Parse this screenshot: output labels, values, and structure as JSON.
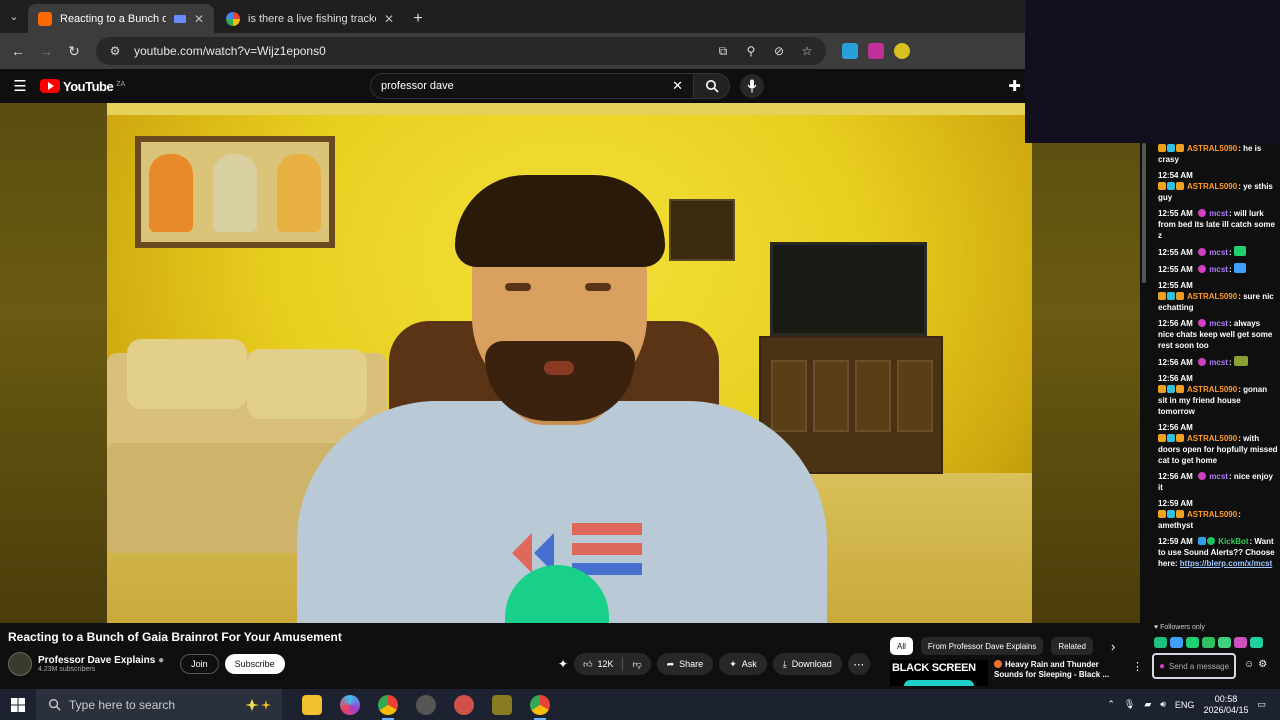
{
  "browser": {
    "tabs": [
      {
        "title": "Reacting to a Bunch of Gaia",
        "active": true
      },
      {
        "title": "is there a live fishing tracker ap",
        "active": false
      }
    ],
    "new_tab": "+",
    "url": "youtube.com/watch?v=Wijz1epons0"
  },
  "youtube": {
    "logo_text": "YouTube",
    "country_code": "ZA",
    "search_query": "professor dave",
    "video_title": "Reacting to a Bunch of Gaia Brainrot For Your Amusement",
    "channel": {
      "name": "Professor Dave Explains",
      "subscribers": "4.23M subscribers",
      "join_label": "Join",
      "subscribe_label": "Subscribe"
    },
    "actions": {
      "likes": "12K",
      "share": "Share",
      "ask": "Ask",
      "download": "Download"
    },
    "chips": [
      "All",
      "From Professor Dave Explains",
      "Related"
    ],
    "recommendation": {
      "thumb_text": "BLACK SCREEN",
      "title": "Heavy Rain and Thunder Sounds for Sleeping - Black ..."
    }
  },
  "chat": {
    "messages": [
      {
        "time": "",
        "user": "ASTRAL5090",
        "text": "he is crasy"
      },
      {
        "time": "12:54 AM",
        "user": "ASTRAL5090",
        "text": "ye sthis guy"
      },
      {
        "time": "12:55 AM",
        "user": "mcst",
        "text": "will lurk from bed its late ill catch some z"
      },
      {
        "time": "12:55 AM",
        "user": "mcst",
        "text": ""
      },
      {
        "time": "12:55 AM",
        "user": "mcst",
        "text": ""
      },
      {
        "time": "12:55 AM",
        "user": "ASTRAL5090",
        "text": "sure nic echatting"
      },
      {
        "time": "12:56 AM",
        "user": "mcst",
        "text": "always nice chats keep well get some rest soon too"
      },
      {
        "time": "12:56 AM",
        "user": "mcst",
        "text": ""
      },
      {
        "time": "12:56 AM",
        "user": "ASTRAL5090",
        "text": "gonan sit in my friend house tomorrow"
      },
      {
        "time": "12:56 AM",
        "user": "ASTRAL5090",
        "text": "with doors open for hopfully missed cat to get home"
      },
      {
        "time": "12:56 AM",
        "user": "mcst",
        "text": "nice enjoy it"
      },
      {
        "time": "12:59 AM",
        "user": "ASTRAL5090",
        "text": "amethyst"
      },
      {
        "time": "12:59 AM",
        "user": "KickBot",
        "text": "Want to use Sound Alerts?? Choose here:",
        "link": "https://blerp.com/x/mcst"
      }
    ],
    "followers_only": "Followers only",
    "send_placeholder": "Send a message"
  },
  "taskbar": {
    "search_placeholder": "Type here to search",
    "language": "ENG",
    "time": "00:58",
    "date": "2026/04/15"
  },
  "colors": {
    "youtube_red": "#ff0000",
    "chat_astral": "#ff9a2e",
    "chat_mcst": "#b07cff",
    "chat_kickbot": "#34d058"
  }
}
